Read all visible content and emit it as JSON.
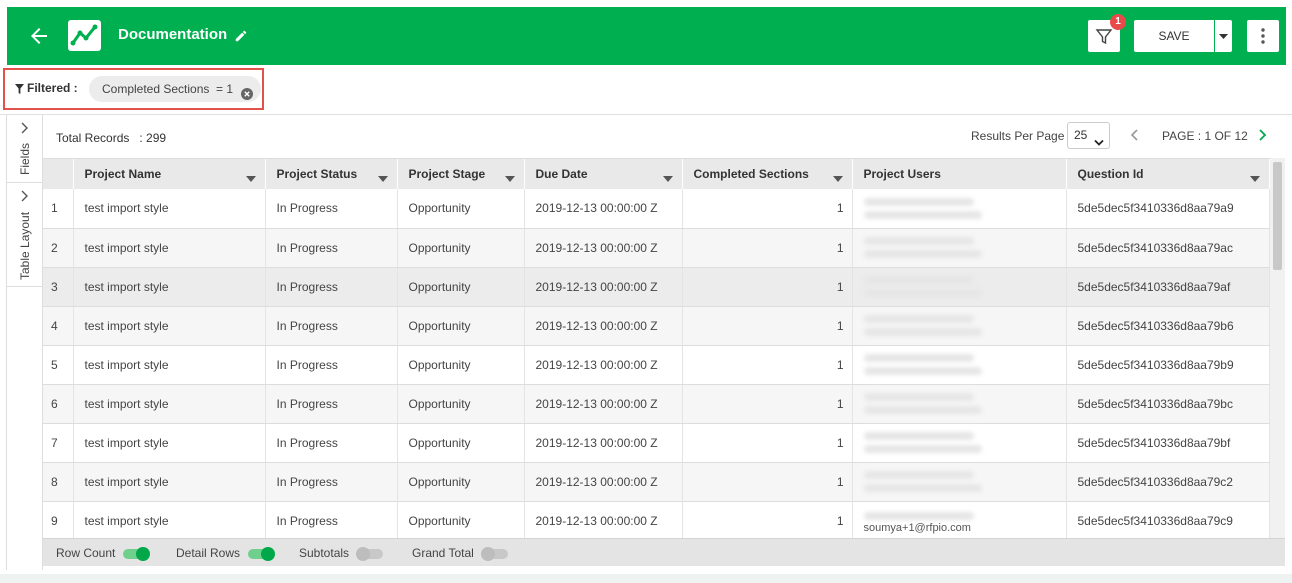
{
  "colors": {
    "brand": "#00b050",
    "badge": "#e84a4a",
    "filter_highlight": "#e0524a",
    "toggle_on": "#00a84a"
  },
  "header": {
    "title": "Documentation",
    "filter_badge_count": "1",
    "save_label": "SAVE",
    "icons": [
      "back-arrow-icon",
      "chart-logo-icon",
      "pencil-icon",
      "funnel-icon",
      "caret-down-icon",
      "kebab-menu-icon"
    ]
  },
  "filter_bar": {
    "label": "Filtered :",
    "chip": "Completed Sections  = 1"
  },
  "side_tabs": {
    "fields": "Fields",
    "table_layout": "Table Layout"
  },
  "toolbar": {
    "total_records": "Total Records   : 299",
    "results_per_page_label": "Results Per Page",
    "results_per_page_value": "25",
    "page_label": "PAGE : 1 OF 12"
  },
  "table": {
    "columns": [
      "Project Name",
      "Project Status",
      "Project Stage",
      "Due Date",
      "Completed Sections",
      "Project Users",
      "Question Id"
    ],
    "rows": [
      {
        "n": "1",
        "name": "test import style",
        "status": "In Progress",
        "stage": "Opportunity",
        "due": "2019-12-13 00:00:00 Z",
        "completed": "1",
        "users": "",
        "qid": "5de5dec5f3410336d8aa79a9"
      },
      {
        "n": "2",
        "name": "test import style",
        "status": "In Progress",
        "stage": "Opportunity",
        "due": "2019-12-13 00:00:00 Z",
        "completed": "1",
        "users": "",
        "qid": "5de5dec5f3410336d8aa79ac"
      },
      {
        "n": "3",
        "name": "test import style",
        "status": "In Progress",
        "stage": "Opportunity",
        "due": "2019-12-13 00:00:00 Z",
        "completed": "1",
        "users": "",
        "qid": "5de5dec5f3410336d8aa79af"
      },
      {
        "n": "4",
        "name": "test import style",
        "status": "In Progress",
        "stage": "Opportunity",
        "due": "2019-12-13 00:00:00 Z",
        "completed": "1",
        "users": "",
        "qid": "5de5dec5f3410336d8aa79b6"
      },
      {
        "n": "5",
        "name": "test import style",
        "status": "In Progress",
        "stage": "Opportunity",
        "due": "2019-12-13 00:00:00 Z",
        "completed": "1",
        "users": "",
        "qid": "5de5dec5f3410336d8aa79b9"
      },
      {
        "n": "6",
        "name": "test import style",
        "status": "In Progress",
        "stage": "Opportunity",
        "due": "2019-12-13 00:00:00 Z",
        "completed": "1",
        "users": "",
        "qid": "5de5dec5f3410336d8aa79bc"
      },
      {
        "n": "7",
        "name": "test import style",
        "status": "In Progress",
        "stage": "Opportunity",
        "due": "2019-12-13 00:00:00 Z",
        "completed": "1",
        "users": "",
        "qid": "5de5dec5f3410336d8aa79bf"
      },
      {
        "n": "8",
        "name": "test import style",
        "status": "In Progress",
        "stage": "Opportunity",
        "due": "2019-12-13 00:00:00 Z",
        "completed": "1",
        "users": "",
        "qid": "5de5dec5f3410336d8aa79c2"
      },
      {
        "n": "9",
        "name": "test import style",
        "status": "In Progress",
        "stage": "Opportunity",
        "due": "2019-12-13 00:00:00 Z",
        "completed": "1",
        "users": "soumya+1@rfpio.com",
        "qid": "5de5dec5f3410336d8aa79c9"
      }
    ]
  },
  "footer": {
    "row_count": "Row Count",
    "detail_rows": "Detail Rows",
    "subtotals": "Subtotals",
    "grand_total": "Grand Total"
  }
}
